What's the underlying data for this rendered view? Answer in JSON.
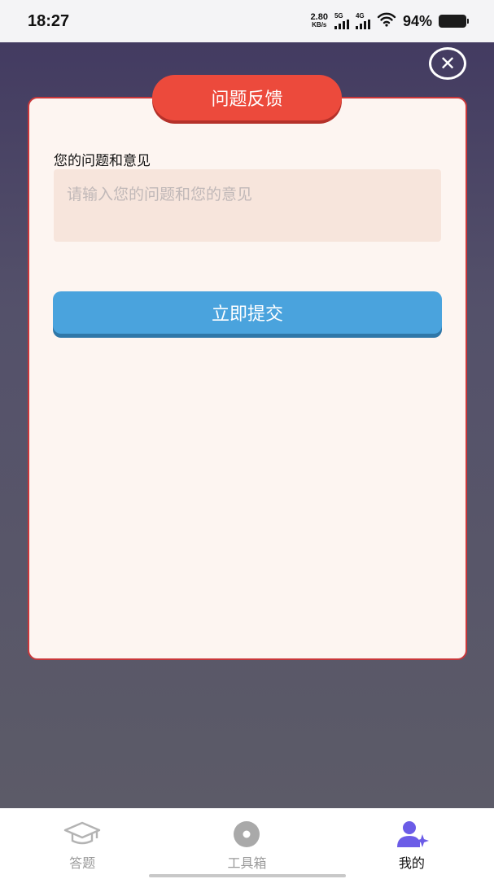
{
  "status_bar": {
    "time": "18:27",
    "net_speed_value": "2.80",
    "net_speed_unit": "KB/s",
    "signal1_label": "5G",
    "signal2_label": "4G",
    "battery": "94%"
  },
  "dialog": {
    "title": "问题反馈",
    "field_label": "您的问题和意见",
    "placeholder": "请输入您的问题和您的意见",
    "submit_label": "立即提交",
    "close_symbol": "✕"
  },
  "tabs": [
    {
      "label": "答题",
      "icon": "graduation-cap-icon",
      "active": false
    },
    {
      "label": "工具箱",
      "icon": "disc-icon",
      "active": false
    },
    {
      "label": "我的",
      "icon": "user-icon",
      "active": true
    }
  ],
  "colors": {
    "title_pill": "#ec4a3c",
    "submit": "#4aa3dd",
    "card_bg": "#fdf5f1",
    "active_tab_icon": "#6b5ce7"
  }
}
